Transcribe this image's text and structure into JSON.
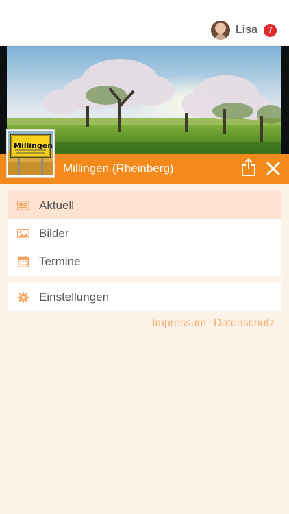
{
  "user": {
    "name": "Lisa",
    "notification_count": "7"
  },
  "header": {
    "title": "Millingen (Rheinberg)"
  },
  "logo": {
    "sign_text": "Millingen"
  },
  "menu": {
    "items": [
      {
        "label": "Aktuell",
        "icon": "newspaper-icon",
        "active": true
      },
      {
        "label": "Bilder",
        "icon": "image-icon",
        "active": false
      },
      {
        "label": "Termine",
        "icon": "calendar-icon",
        "active": false
      }
    ]
  },
  "settings": {
    "label": "Einstellungen",
    "icon": "gear-icon"
  },
  "footer": {
    "impressum": "Impressum",
    "datenschutz": "Datenschutz"
  },
  "colors": {
    "accent": "#f48a1b",
    "active_row": "#fde3d0",
    "icon": "#f5a35c",
    "background": "#fdf2e8",
    "badge": "#e2282e",
    "link": "#f5b173"
  }
}
